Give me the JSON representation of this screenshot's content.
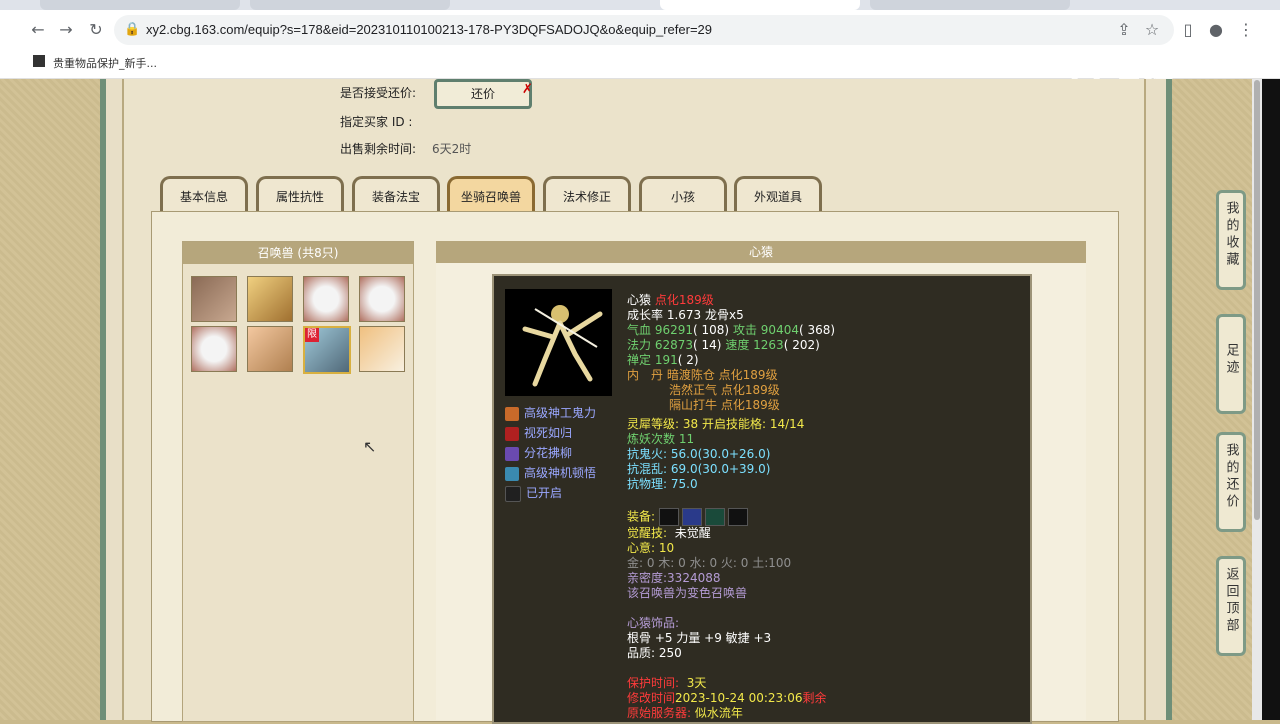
{
  "browser": {
    "url": "xy2.cbg.163.com/equip?s=178&eid=202310110100213-178-PY3DQFSADOJQ&o&equip_refer=29",
    "bookmark": "贵重物品保护_新手..."
  },
  "watermark": "CC直播",
  "trade": {
    "accept_label": "是否接受还价:",
    "haggle_button": "还价",
    "buyer_label": "指定买家 ID :",
    "remaining_label": "出售剩余时间:",
    "remaining_value": "6天2时"
  },
  "tabs": [
    "基本信息",
    "属性抗性",
    "装备法宝",
    "坐骑召唤兽",
    "法术修正",
    "小孩",
    "外观道具"
  ],
  "left_panel": {
    "title": "召唤兽 (共8只)",
    "limited_badge": "限"
  },
  "right_panel": {
    "title": "心猿"
  },
  "pet": {
    "name": "心猿",
    "name_tag": "点化189级",
    "growth": "成长率 1.673 龙骨x5",
    "hp_label": "气血",
    "hp_value": "96291",
    "hp_extra": "( 108)",
    "atk_label": "攻击",
    "atk_value": "90404",
    "atk_extra": "( 368)",
    "mp_label": "法力",
    "mp_value": "62873",
    "mp_extra": "( 14)",
    "spd_label": "速度",
    "spd_value": "1263",
    "spd_extra": "( 202)",
    "calm_label": "禅定",
    "calm_value": "191",
    "calm_extra": "( 2)",
    "core_label": "内　丹",
    "cores": [
      "暗渡陈仓 点化189级",
      "浩然正气 点化189级",
      "隔山打牛 点化189级"
    ],
    "rhino_label": "灵犀等级:",
    "rhino_value": "38",
    "rhino_skill_label": "开启技能格:",
    "rhino_skill_value": "14/14",
    "refine_label": "炼妖次数",
    "refine_value": "11",
    "res1": "抗鬼火: 56.0(30.0+26.0)",
    "res2": "抗混乱: 69.0(30.0+39.0)",
    "res3": "抗物理: 75.0",
    "equip_label": "装备:",
    "awaken_label": "觉醒技:",
    "awaken_value": "未觉醒",
    "heart_label": "心意:",
    "heart_value": "10",
    "elements": "金: 0 木: 0 水: 0 火: 0 土:100",
    "intimacy": "亲密度:3324088",
    "variant": "该召唤兽为变色召唤兽",
    "accessory_title": "心猿饰品:",
    "accessory_stats": "根骨 +5 力量 +9 敏捷 +3",
    "quality": "品质: 250",
    "protect_label": "保护时间:",
    "protect_value": "3天",
    "change_label": "修改时间",
    "change_value": "2023-10-24 00:23:06",
    "change_suffix": "剩余",
    "server_label": "原始服务器:",
    "server_value": "似水流年"
  },
  "skills": [
    {
      "label": "高级神工鬼力",
      "icon": "fist-icon",
      "color": "#c86a2a"
    },
    {
      "label": "视死如归",
      "icon": "blade-icon",
      "color": "#b02020"
    },
    {
      "label": "分花拂柳",
      "icon": "flower-icon",
      "color": "#6a4ab0"
    },
    {
      "label": "高级神机顿悟",
      "icon": "gear-icon",
      "color": "#3a8ab0"
    },
    {
      "label": "已开启",
      "icon": "lock-icon",
      "color": "#202020"
    }
  ],
  "side_buttons": [
    "我的收藏",
    "足迹",
    "我的还价",
    "返回顶部"
  ]
}
